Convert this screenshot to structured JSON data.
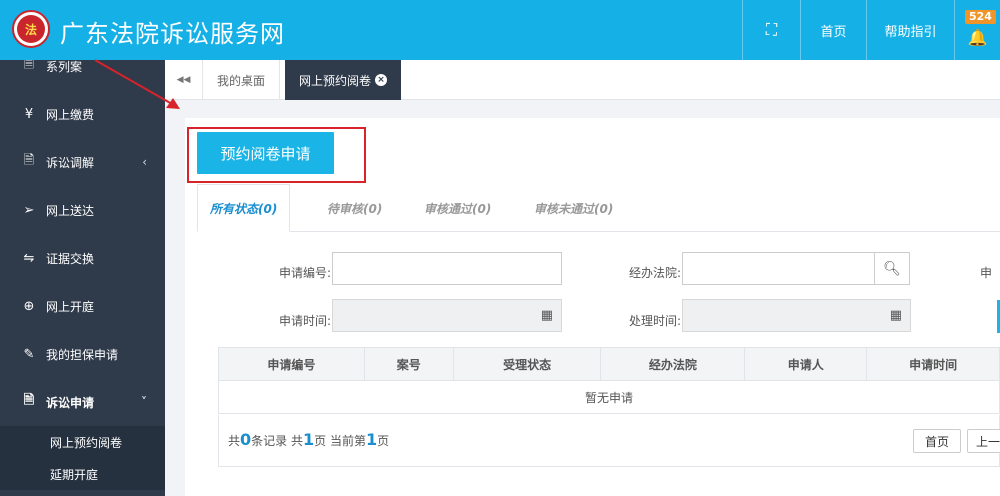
{
  "header": {
    "site_title": "广东法院诉讼服务网",
    "logo_glyph": "法",
    "nav": {
      "fullscreen_icon": "⛶",
      "home": "首页",
      "help": "帮助指引",
      "bell_icon": "🔔",
      "badge_count": "524"
    }
  },
  "sidebar": {
    "items": [
      {
        "icon": "🗎",
        "label": "系列案"
      },
      {
        "icon": "¥",
        "label": "网上缴费"
      },
      {
        "icon": "🗎",
        "label": "诉讼调解",
        "arrow": "‹"
      },
      {
        "icon": "➢",
        "label": "网上送达"
      },
      {
        "icon": "⇋",
        "label": "证据交换"
      },
      {
        "icon": "⊕",
        "label": "网上开庭"
      },
      {
        "icon": "✎",
        "label": "我的担保申请"
      },
      {
        "icon": "🗎",
        "label": "诉讼申请",
        "arrow": "˅"
      }
    ],
    "sub_items": [
      "网上预约阅卷",
      "延期开庭"
    ]
  },
  "tabs": {
    "back_icon": "◀◀",
    "desk": "我的桌面",
    "active": "网上预约阅卷",
    "close_icon": "×"
  },
  "content": {
    "apply_button": "预约阅卷申请",
    "status_tabs": [
      "所有状态(0)",
      "待审核(0)",
      "审核通过(0)",
      "审核未通过(0)"
    ],
    "form": {
      "apply_no_label": "申请编号:",
      "court_label": "经办法院:",
      "apply_time_label": "申请时间:",
      "handle_time_label": "处理时间:",
      "right_cut_label": "申"
    },
    "table": {
      "headers": [
        "申请编号",
        "案号",
        "受理状态",
        "经办法院",
        "申请人",
        "申请时间"
      ],
      "empty_text": "暂无申请"
    },
    "pager": {
      "prefix": "共",
      "records": "0",
      "records_suffix": "条记录 共",
      "pages": "1",
      "pages_suffix": "页 当前第",
      "current": "1",
      "current_suffix": "页",
      "first_btn": "首页",
      "prev_btn": "上一"
    }
  },
  "colors": {
    "header_bg": "#15b0e6",
    "sidebar_bg": "#2f3a4a",
    "accent_red": "#d9232b",
    "badge": "#f0952a"
  }
}
